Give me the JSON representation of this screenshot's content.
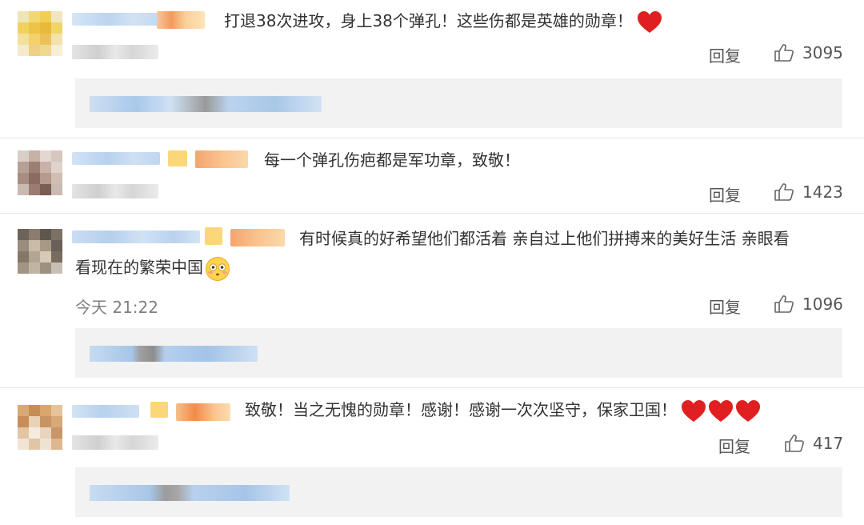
{
  "comments": [
    {
      "text_lines": [
        "打退38次进攻，身上38个弹孔！这些伤都是英雄的勋章！"
      ],
      "emoji": "heart",
      "time": "",
      "reply_label": "回复",
      "likes": "3095"
    },
    {
      "text_lines": [
        "每一个弹孔伤疤都是军功章，致敬！"
      ],
      "emoji": "",
      "time": "",
      "reply_label": "回复",
      "likes": "1423"
    },
    {
      "text_lines": [
        "有时候真的好希望他们都活着 亲自过上他们拼搏来的美好生活 亲眼看",
        "看现在的繁荣中国"
      ],
      "emoji": "flushed-face",
      "time": "今天 21:22",
      "reply_label": "回复",
      "likes": "1096"
    },
    {
      "text_lines": [
        "致敬！当之无愧的勋章！感谢！感谢一次次坚守，保家卫国！"
      ],
      "emoji": "heart x3",
      "time": "",
      "reply_label": "回复",
      "likes": "417"
    }
  ],
  "colors": {
    "text": "#333333",
    "muted": "#808080",
    "reply_box": "#f2f2f2",
    "heart": "#e02020",
    "blur_blue": "#c9def2",
    "blur_orange": "#f7b27a",
    "blur_yellow": "#fbd780"
  }
}
